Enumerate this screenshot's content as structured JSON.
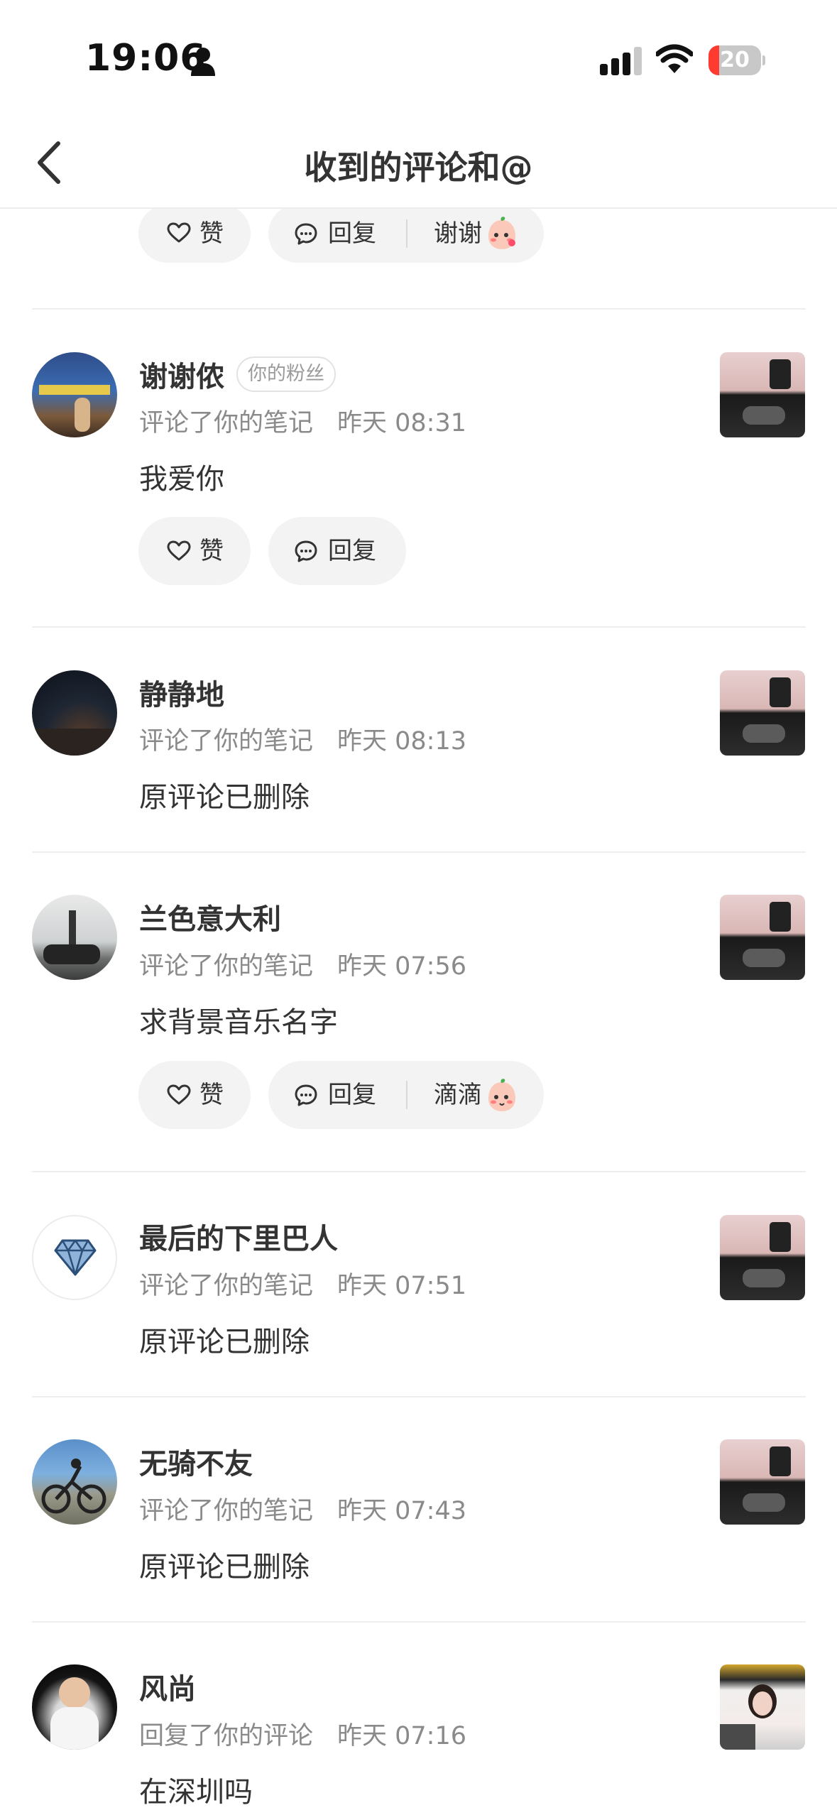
{
  "status_bar": {
    "time": "19:06",
    "battery_percent": "20",
    "battery_level": 0.2
  },
  "nav": {
    "title": "收到的评论和@"
  },
  "top_actions": {
    "like": "赞",
    "reply": "回复",
    "quick_reply": "谢谢"
  },
  "items": [
    {
      "name": "谢谢侬",
      "badge": "你的粉丝",
      "action": "评论了你的笔记",
      "time": "昨天 08:31",
      "comment": "我爱你",
      "like": "赞",
      "reply": "回复"
    },
    {
      "name": "静静地",
      "action": "评论了你的笔记",
      "time": "昨天 08:13",
      "comment": "原评论已删除"
    },
    {
      "name": "兰色意大利",
      "action": "评论了你的笔记",
      "time": "昨天 07:56",
      "comment": "求背景音乐名字",
      "like": "赞",
      "reply": "回复",
      "quick_reply": "滴滴"
    },
    {
      "name": "最后的下里巴人",
      "action": "评论了你的笔记",
      "time": "昨天 07:51",
      "comment": "原评论已删除"
    },
    {
      "name": "无骑不友",
      "action": "评论了你的笔记",
      "time": "昨天 07:43",
      "comment": "原评论已删除"
    },
    {
      "name": "风尚",
      "action": "回复了你的评论",
      "time": "昨天 07:16",
      "comment": "在深圳吗"
    }
  ]
}
